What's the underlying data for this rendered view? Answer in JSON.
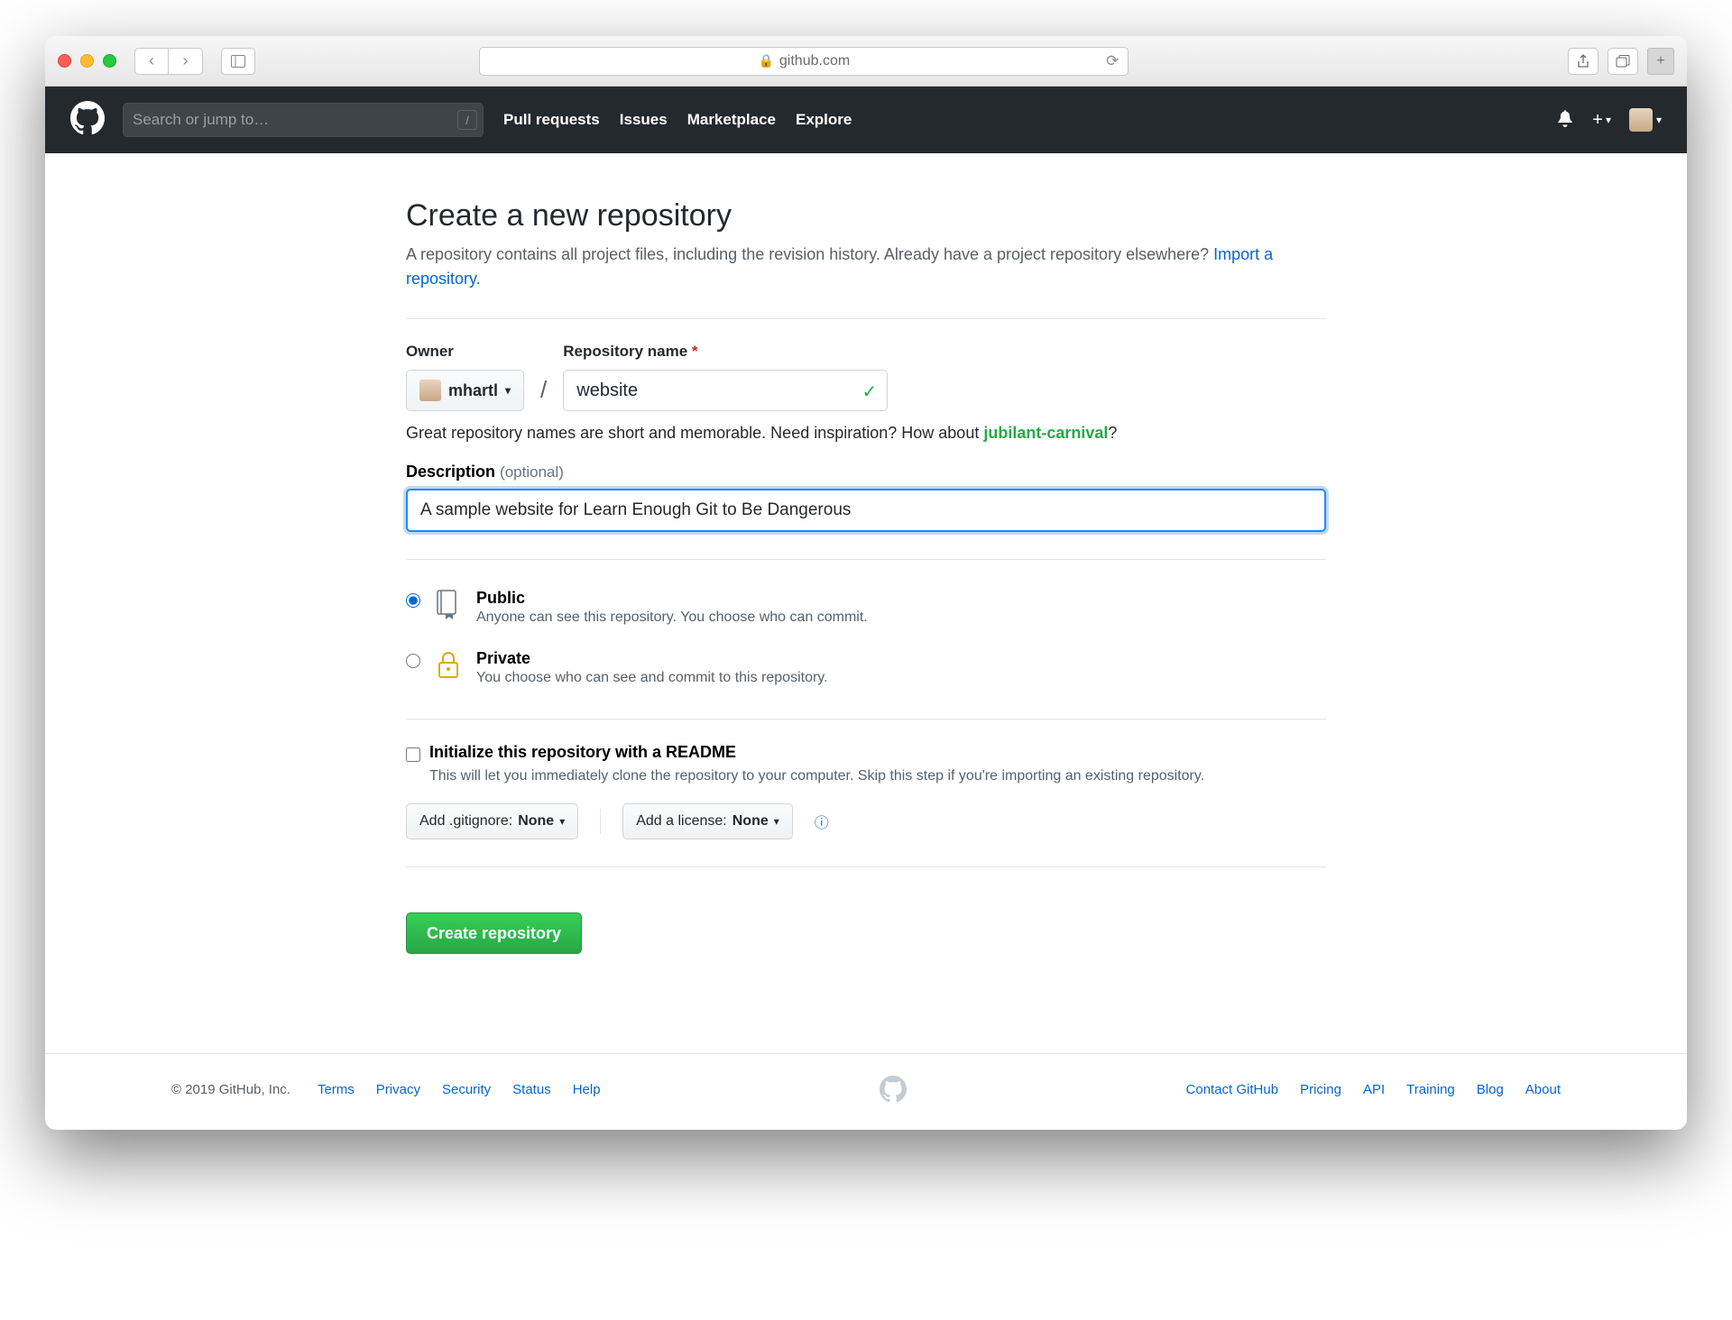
{
  "browser": {
    "domain": "github.com"
  },
  "header": {
    "search_placeholder": "Search or jump to…",
    "nav": {
      "pulls": "Pull requests",
      "issues": "Issues",
      "marketplace": "Marketplace",
      "explore": "Explore"
    }
  },
  "page": {
    "title": "Create a new repository",
    "subtitle_prefix": "A repository contains all project files, including the revision history. Already have a project repository elsewhere? ",
    "import_link": "Import a repository.",
    "owner_label": "Owner",
    "reponame_label": "Repository name",
    "owner": "mhartl",
    "repo_name": "website",
    "hint_prefix": "Great repository names are short and memorable. Need inspiration? How about ",
    "hint_suggest": "jubilant-carnival",
    "hint_suffix": "?",
    "desc_label": "Description",
    "desc_optional": "(optional)",
    "desc_value": "A sample website for Learn Enough Git to Be Dangerous",
    "visibility": {
      "public": {
        "title": "Public",
        "desc": "Anyone can see this repository. You choose who can commit."
      },
      "private": {
        "title": "Private",
        "desc": "You choose who can see and commit to this repository."
      }
    },
    "readme": {
      "title": "Initialize this repository with a README",
      "desc": "This will let you immediately clone the repository to your computer. Skip this step if you're importing an existing repository."
    },
    "gitignore_label": "Add .gitignore: ",
    "gitignore_value": "None",
    "license_label": "Add a license: ",
    "license_value": "None",
    "submit": "Create repository"
  },
  "footer": {
    "copyright": "© 2019 GitHub, Inc.",
    "left": {
      "terms": "Terms",
      "privacy": "Privacy",
      "security": "Security",
      "status": "Status",
      "help": "Help"
    },
    "right": {
      "contact": "Contact GitHub",
      "pricing": "Pricing",
      "api": "API",
      "training": "Training",
      "blog": "Blog",
      "about": "About"
    }
  }
}
